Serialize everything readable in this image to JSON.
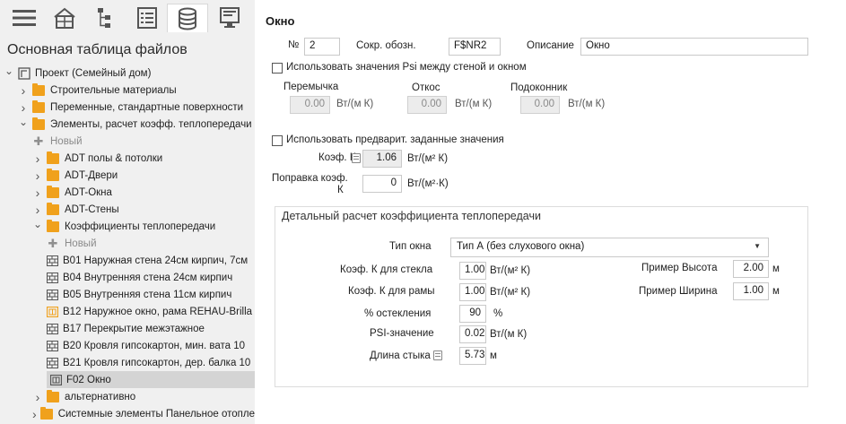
{
  "toolbar": {
    "buttons": [
      {
        "icon": "hamburger-menu-icon"
      },
      {
        "icon": "building-icon"
      },
      {
        "icon": "hierarchy-icon"
      },
      {
        "icon": "list-icon"
      },
      {
        "icon": "database-icon",
        "active": true
      },
      {
        "icon": "monitor-icon"
      }
    ]
  },
  "left": {
    "title": "Основная таблица файлов",
    "tree": [
      {
        "label": "Проект (Семейный дом)",
        "level": 0,
        "expanded": true,
        "icon": "project"
      },
      {
        "label": "Строительные материалы",
        "level": 1,
        "expanded": false,
        "icon": "folder"
      },
      {
        "label": "Переменные, стандартные поверхности",
        "level": 1,
        "expanded": false,
        "icon": "folder"
      },
      {
        "label": "Элементы, расчет коэфф. теплопередачи",
        "level": 1,
        "expanded": true,
        "icon": "folder"
      },
      {
        "label": "Новый",
        "level": 2,
        "icon": "plus",
        "muted": true
      },
      {
        "label": "ADT полы & потолки",
        "level": 2,
        "expanded": false,
        "icon": "folder"
      },
      {
        "label": "ADT-Двери",
        "level": 2,
        "expanded": false,
        "icon": "folder"
      },
      {
        "label": "ADT-Окна",
        "level": 2,
        "expanded": false,
        "icon": "folder"
      },
      {
        "label": "ADT-Стены",
        "level": 2,
        "expanded": false,
        "icon": "folder"
      },
      {
        "label": "Коэффициенты теплопередачи",
        "level": 2,
        "expanded": true,
        "icon": "folder"
      },
      {
        "label": "Новый",
        "level": 3,
        "icon": "plus",
        "muted": true
      },
      {
        "label": "B01 Наружная стена 24см кирпич, 7см",
        "level": 3,
        "icon": "wall"
      },
      {
        "label": "B04 Внутренняя стена 24см кирпич",
        "level": 3,
        "icon": "wall"
      },
      {
        "label": "B05 Внутренняя стена 11см кирпич",
        "level": 3,
        "icon": "wall"
      },
      {
        "label": "B12 Наружное окно, рама REHAU-Brilla",
        "level": 3,
        "icon": "window-yellow"
      },
      {
        "label": "B17 Перекрытие межэтажное",
        "level": 3,
        "icon": "wall"
      },
      {
        "label": "B20 Кровля гипсокартон, мин. вата 10",
        "level": 3,
        "icon": "wall"
      },
      {
        "label": "B21 Кровля гипсокартон, дер. балка 10",
        "level": 3,
        "icon": "wall"
      },
      {
        "label": "F02 Окно",
        "level": 3,
        "icon": "window",
        "selected": true
      },
      {
        "label": "альтернативно",
        "level": 2,
        "expanded": false,
        "icon": "folder"
      },
      {
        "label": "Системные элементы Панельное отопле",
        "level": 2,
        "expanded": false,
        "icon": "folder"
      }
    ]
  },
  "form": {
    "title": "Окно",
    "number_label": "№",
    "number_value": "2",
    "abbr_label": "Сокр. обозн.",
    "abbr_value": "F$NR2",
    "desc_label": "Описание",
    "desc_value": "Окно",
    "psi_checkbox_label": "Использовать значения Psi между стеной и окном",
    "psi": {
      "lintel_label": "Перемычка",
      "lintel_value": "0.00",
      "reveal_label": "Откос",
      "reveal_value": "0.00",
      "sill_label": "Подоконник",
      "sill_value": "0.00",
      "unit": "Вт/(м К)"
    },
    "preset_checkbox_label": "Использовать предварит. заданные значения",
    "k_label": "Коэф. К",
    "k_value": "1.06",
    "k_unit": "Вт/(м² К)",
    "correction_label_line1": "Поправка коэф.",
    "correction_label_line2": "К",
    "correction_value": "0",
    "correction_unit": "Вт/(м²·К)"
  },
  "detail": {
    "title": "Детальный расчет коэффициента теплопередачи",
    "window_type_label": "Тип окна",
    "window_type_value": "Тип А (без слухового окна)",
    "glass_k_label": "Коэф. К для стекла",
    "glass_k_value": "1.00",
    "glass_k_unit": "Вт/(м² К)",
    "frame_k_label": "Коэф. К для рамы",
    "frame_k_value": "1.00",
    "frame_k_unit": "Вт/(м² К)",
    "glazing_label": "% остекления",
    "glazing_value": "90",
    "glazing_unit": "%",
    "psi_label": "PSI-значение",
    "psi_value": "0.02",
    "psi_unit": "Вт/(м К)",
    "joint_label": "Длина стыка",
    "joint_value": "5.73",
    "joint_unit": "м",
    "height_label": "Пример Высота",
    "height_value": "2.00",
    "height_unit": "м",
    "width_label": "Пример Ширина",
    "width_value": "1.00",
    "width_unit": "м"
  }
}
